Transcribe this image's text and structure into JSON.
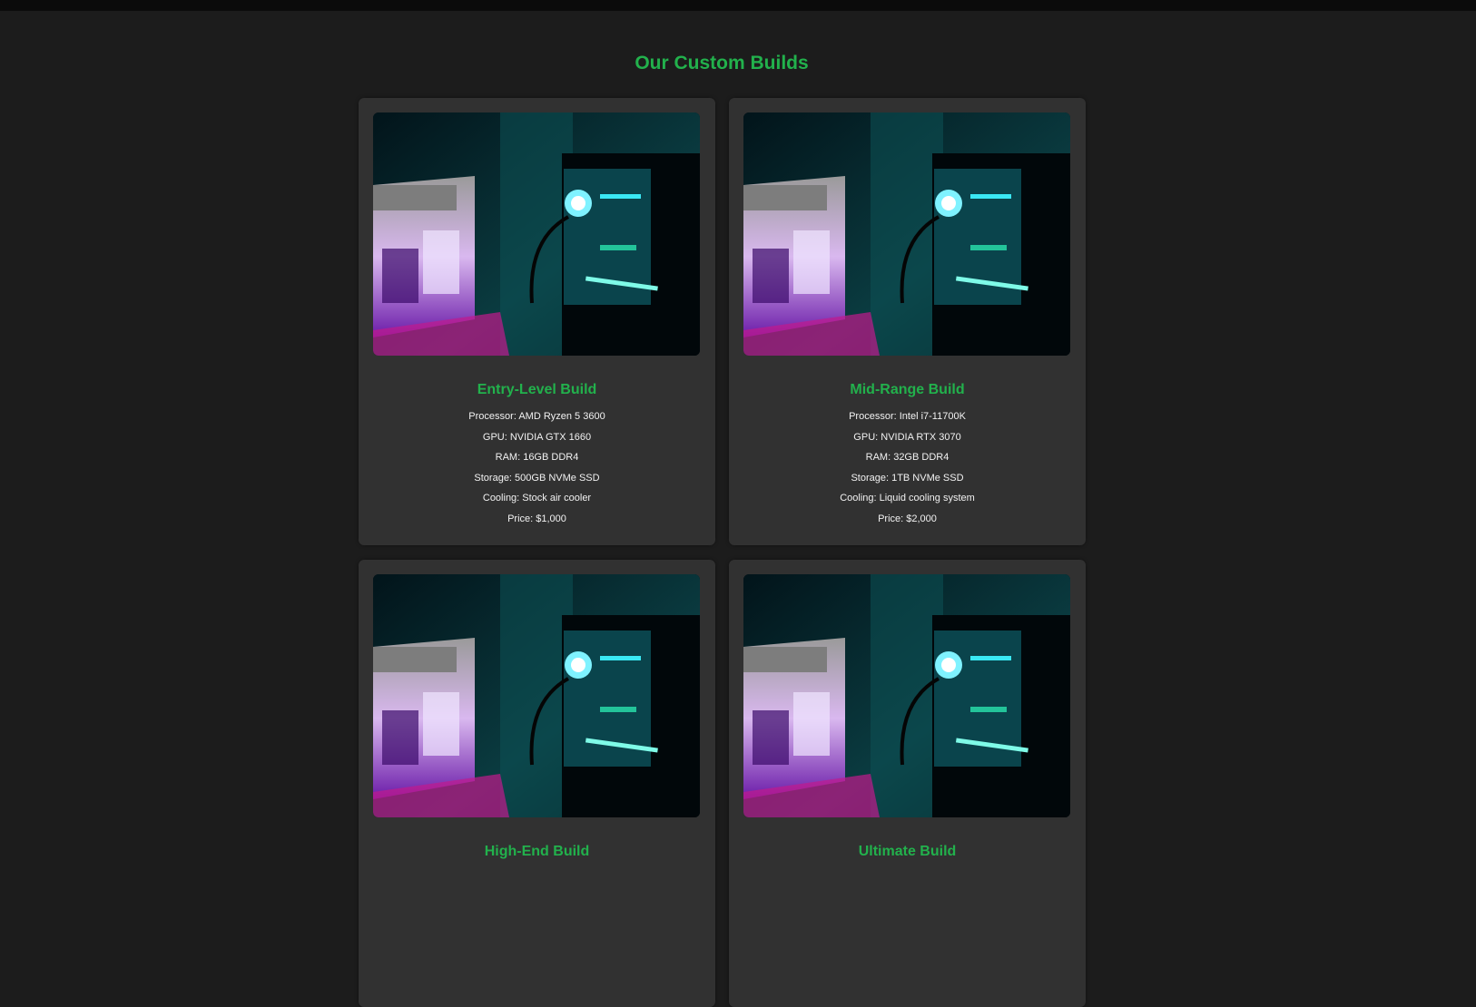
{
  "page": {
    "title": "Our Custom Builds"
  },
  "colors": {
    "accent": "#22b14c",
    "background": "#1c1c1c",
    "card": "#313131",
    "text": "#f2f2f2"
  },
  "builds": [
    {
      "name": "Entry-Level Build",
      "specs": [
        "Processor: AMD Ryzen 5 3600",
        "GPU: NVIDIA GTX 1660",
        "RAM: 16GB DDR4",
        "Storage: 500GB NVMe SSD",
        "Cooling: Stock air cooler",
        "Price: $1,000"
      ]
    },
    {
      "name": "Mid-Range Build",
      "specs": [
        "Processor: Intel i7-11700K",
        "GPU: NVIDIA RTX 3070",
        "RAM: 32GB DDR4",
        "Storage: 1TB NVMe SSD",
        "Cooling: Liquid cooling system",
        "Price: $2,000"
      ]
    },
    {
      "name": "High-End Build",
      "specs": []
    },
    {
      "name": "Ultimate Build",
      "specs": []
    }
  ]
}
